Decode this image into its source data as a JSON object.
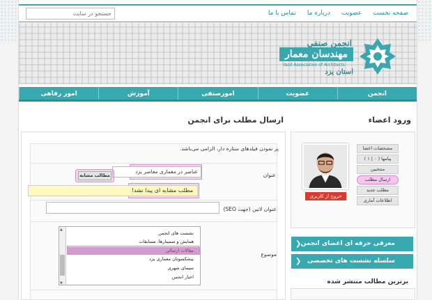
{
  "search": {
    "placeholder": "جستجو در سایت"
  },
  "top_nav": [
    "صفحه نخست",
    "عضویت",
    "درباره ما",
    "تماس با ما"
  ],
  "logo": {
    "title": "انجمن صنفی",
    "main": "مهندسان معمار",
    "english": "Yazd Association of Architects",
    "sub": "استان یزد"
  },
  "main_nav": [
    "انجمن",
    "عضویت",
    "امورصنفی",
    "آموزش",
    "امور رفاهی"
  ],
  "form": {
    "heading": "ارسال مطلب برای انجمن",
    "required_note": "پر نمودن فیلدهای ستاره دار، الزامی می‌باشد.",
    "title_label": "عنوان",
    "title_value": "عناصر در معماری معاصر یزد",
    "similar_button": "مطالب مشابه",
    "not_found": "مطلب مشابه ای پیدا نشد!",
    "seo_label": "عنوان لاتین (جهت SEO)",
    "subject_label": "موضوع",
    "subject_options": [
      "نشست های انجمن",
      "همایش و سمینارها، مسابقات",
      "مقالات ارسالی",
      "پیشکسوتان معماری یزد",
      "سیمای شهری",
      "اخبار انجمن"
    ],
    "subject_selected_index": 2
  },
  "login": {
    "heading": "ورود اعضاء",
    "logout": "خروج از کاربری",
    "menu": [
      "مشخصات اعضا",
      "پیامها ( ۰ | ۱ )",
      "منتخبین",
      "ارسال مطلب",
      "مطلب جدید",
      "اطلاعات آماری"
    ],
    "highlighted_index": 3
  },
  "side_bars": [
    "معرفی حرفه ای اعضای انجمن",
    "سلسله نشست های تخصصی"
  ],
  "latest": {
    "heading": "برترین مطالب منتشر شده"
  },
  "colors": {
    "accent": "#39a9b1",
    "highlight": "#d590cf",
    "danger": "#d93a2f",
    "notice": "#fff9c0"
  }
}
